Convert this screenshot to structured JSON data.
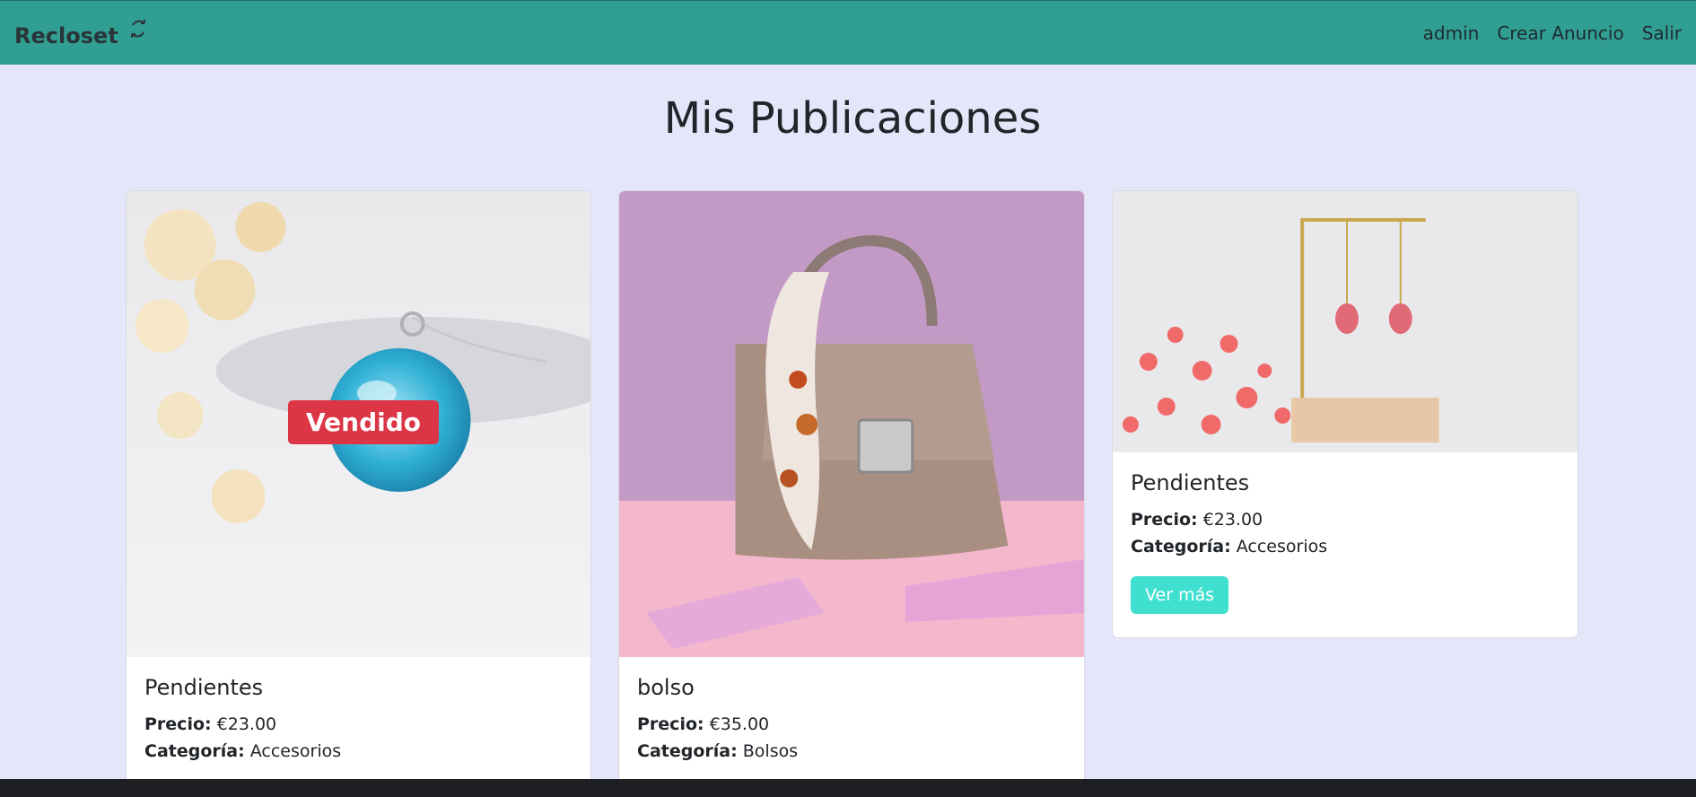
{
  "navbar": {
    "brand": "Recloset",
    "brand_icon": "sync-icon",
    "links": [
      "admin",
      "Crear Anuncio",
      "Salir"
    ],
    "bg_color": "#319e94"
  },
  "page": {
    "title": "Mis Publicaciones",
    "bg_color": "#e6e6fa"
  },
  "cards": [
    {
      "title": "Pendientes",
      "price_label": "Precio:",
      "price": "€23.00",
      "category_label": "Categoría:",
      "category": "Accesorios",
      "badge": "Vendido",
      "image": "blue-pendant-necklace-photo"
    },
    {
      "title": "bolso",
      "price_label": "Precio:",
      "price": "€35.00",
      "category_label": "Categoría:",
      "category": "Bolsos",
      "image": "taupe-handbag-photo"
    },
    {
      "title": "Pendientes",
      "price_label": "Precio:",
      "price": "€23.00",
      "category_label": "Categoría:",
      "category": "Accesorios",
      "button": "Ver más",
      "image": "red-drop-earrings-photo"
    }
  ],
  "colors": {
    "sold_badge": "#dc3545",
    "button": "#40e0d0"
  }
}
